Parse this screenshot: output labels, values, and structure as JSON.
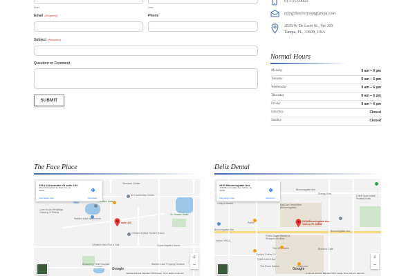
{
  "form": {
    "first_label": "First",
    "last_label": "Last",
    "email_label": "Email",
    "email_required": "(Required)",
    "phone_label": "Phone",
    "subject_label": "Subject",
    "subject_required": "(Required)",
    "question_label": "Question or Comment",
    "submit_label": "SUBMIT"
  },
  "contact": {
    "phone": "813-353-0023",
    "email": "info@foreveryoungtampa.com",
    "address_line1": "2835 W De Leon St., Ste 203",
    "address_line2": "Tampa, FL, 33609, USA"
  },
  "hours": {
    "title": "Normal Hours",
    "rows": [
      {
        "day": "Monday",
        "time": "9 am – 6 pm"
      },
      {
        "day": "Tuesday",
        "time": "9 am – 6 pm"
      },
      {
        "day": "Wednesday",
        "time": "9 am – 6 pm"
      },
      {
        "day": "Thursday",
        "time": "9 am – 6 pm"
      },
      {
        "day": "Friday",
        "time": "9 am – 6 pm"
      },
      {
        "day": "Saturday",
        "time": "Closed"
      },
      {
        "day": "Sunday",
        "time": "Closed"
      }
    ]
  },
  "locations": [
    {
      "title": "The Face Place",
      "card_title": "1514 S Alexander St suite 102",
      "card_address": "1514 S Alexander St, Plant City, FL 33563",
      "directions_label": "Directions",
      "larger_map": "View larger map",
      "pin_label": "suite 102",
      "places": [
        "Dinosaur Center",
        "Lone Knots Weddings Catering & Events",
        "Walden Lake Apartments",
        "Walden Lake",
        "Air Leadership Center",
        "Dr. Hocker Smith",
        "Children's Most Gentle Church",
        "O'Brien's Irish Pub & Grill",
        "Strawberry Field Hospital",
        "Walden Lake Property Owners",
        "Grace Baptist Church"
      ],
      "footer": [
        "Keyboard shortcuts",
        "Map data ©2023 Google",
        "Terms",
        "Report a map error"
      ]
    },
    {
      "title": "Deliz Dental",
      "card_title": "2440 Bloomingdale Ave",
      "card_address": "2440 Bloomingdale Ave, Valrico, FL 33596",
      "directions_label": "Directions",
      "larger_map": "View larger map",
      "pin_label": "2440 Bloomingdale Ave, Valrico, FL 33596",
      "places": [
        "Bloomingdale Ave",
        "Lucky's Market",
        "BayCare HealthHub (Bloomingdale)",
        "Energy Now",
        "LNKE Spot Install Professionals",
        "Publix",
        "Bloomingdale Ave",
        "Valrico YMCA",
        "Publix Super Market at Shoppes of Lithia",
        "The UPS Store",
        "Cecily's Coffee Co",
        "Chili's Grill & Bar",
        "The Fresh Market",
        "Starbucks",
        "Brandon Cafe",
        "Bloomingdale Ave"
      ],
      "footer": [
        "Keyboard shortcuts",
        "Map data ©2023 Google",
        "Terms",
        "Report a map error"
      ]
    }
  ],
  "map_ui": {
    "zoom_in": "+",
    "zoom_out": "−",
    "google": "Google"
  },
  "colors": {
    "accent": "#3b66b0",
    "pin": "#e53935"
  }
}
